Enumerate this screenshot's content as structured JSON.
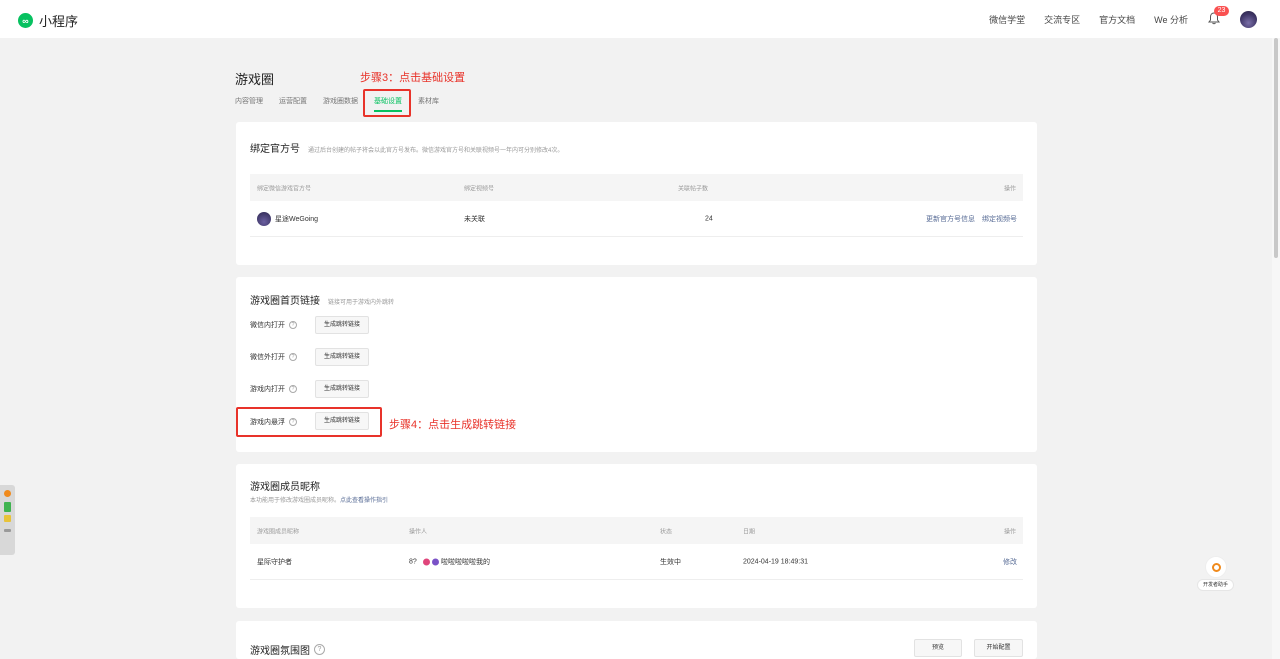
{
  "app": {
    "logo_text": "小程序",
    "logo_icon": "mini-program-logo"
  },
  "topnav": [
    "微信学堂",
    "交流专区",
    "官方文档",
    "We 分析"
  ],
  "notifications": {
    "count": "23"
  },
  "page": {
    "title": "游戏圈"
  },
  "tabs": [
    {
      "label": "内容管理",
      "active": false
    },
    {
      "label": "运营配置",
      "active": false
    },
    {
      "label": "游戏圈数据",
      "active": false
    },
    {
      "label": "基础设置",
      "active": true
    },
    {
      "label": "素材库",
      "active": false
    }
  ],
  "annotations": {
    "step3": "步骤3：点击基础设置",
    "step4": "步骤4：点击生成跳转链接",
    "color": "#e8332a"
  },
  "bind_account": {
    "title": "绑定官方号",
    "desc": "通过后台创建的帖子将会以此官方号发布。微信游戏官方号和关联视频号一年内可分别修改4次。",
    "headers": [
      "绑定微信游戏官方号",
      "绑定视频号",
      "关联帖子数",
      "操作"
    ],
    "row": {
      "name": "星途WeGoing",
      "video": "未关联",
      "posts": "24",
      "action1": "更新官方号信息",
      "action2": "绑定视频号"
    }
  },
  "home_links": {
    "title": "游戏圈首页链接",
    "desc": "链接可用于游戏内外跳转",
    "items": [
      {
        "label": "微信内打开",
        "button": "生成跳转链接"
      },
      {
        "label": "微信外打开",
        "button": "生成跳转链接"
      },
      {
        "label": "游戏内打开",
        "button": "生成跳转链接"
      },
      {
        "label": "游戏内悬浮",
        "button": "生成跳转链接"
      }
    ]
  },
  "nickname": {
    "title": "游戏圈成员昵称",
    "desc": "本功能用于修改游戏圈成员昵称。",
    "desc_link": "点此查看操作指引",
    "headers": [
      "游戏圈成员昵称",
      "操作人",
      "状态",
      "日期",
      "操作"
    ],
    "row": {
      "nickname": "星际守护者",
      "operator_prefix": "8?",
      "operator": "啦啦啦啦啦我的",
      "status": "生效中",
      "date": "2024-04-19 18:49:31",
      "action": "修改"
    }
  },
  "atmosphere": {
    "title": "游戏圈氛围图",
    "preview": "预览",
    "configure": "开始配置"
  },
  "float_widget": {
    "label": "开发者助手"
  }
}
